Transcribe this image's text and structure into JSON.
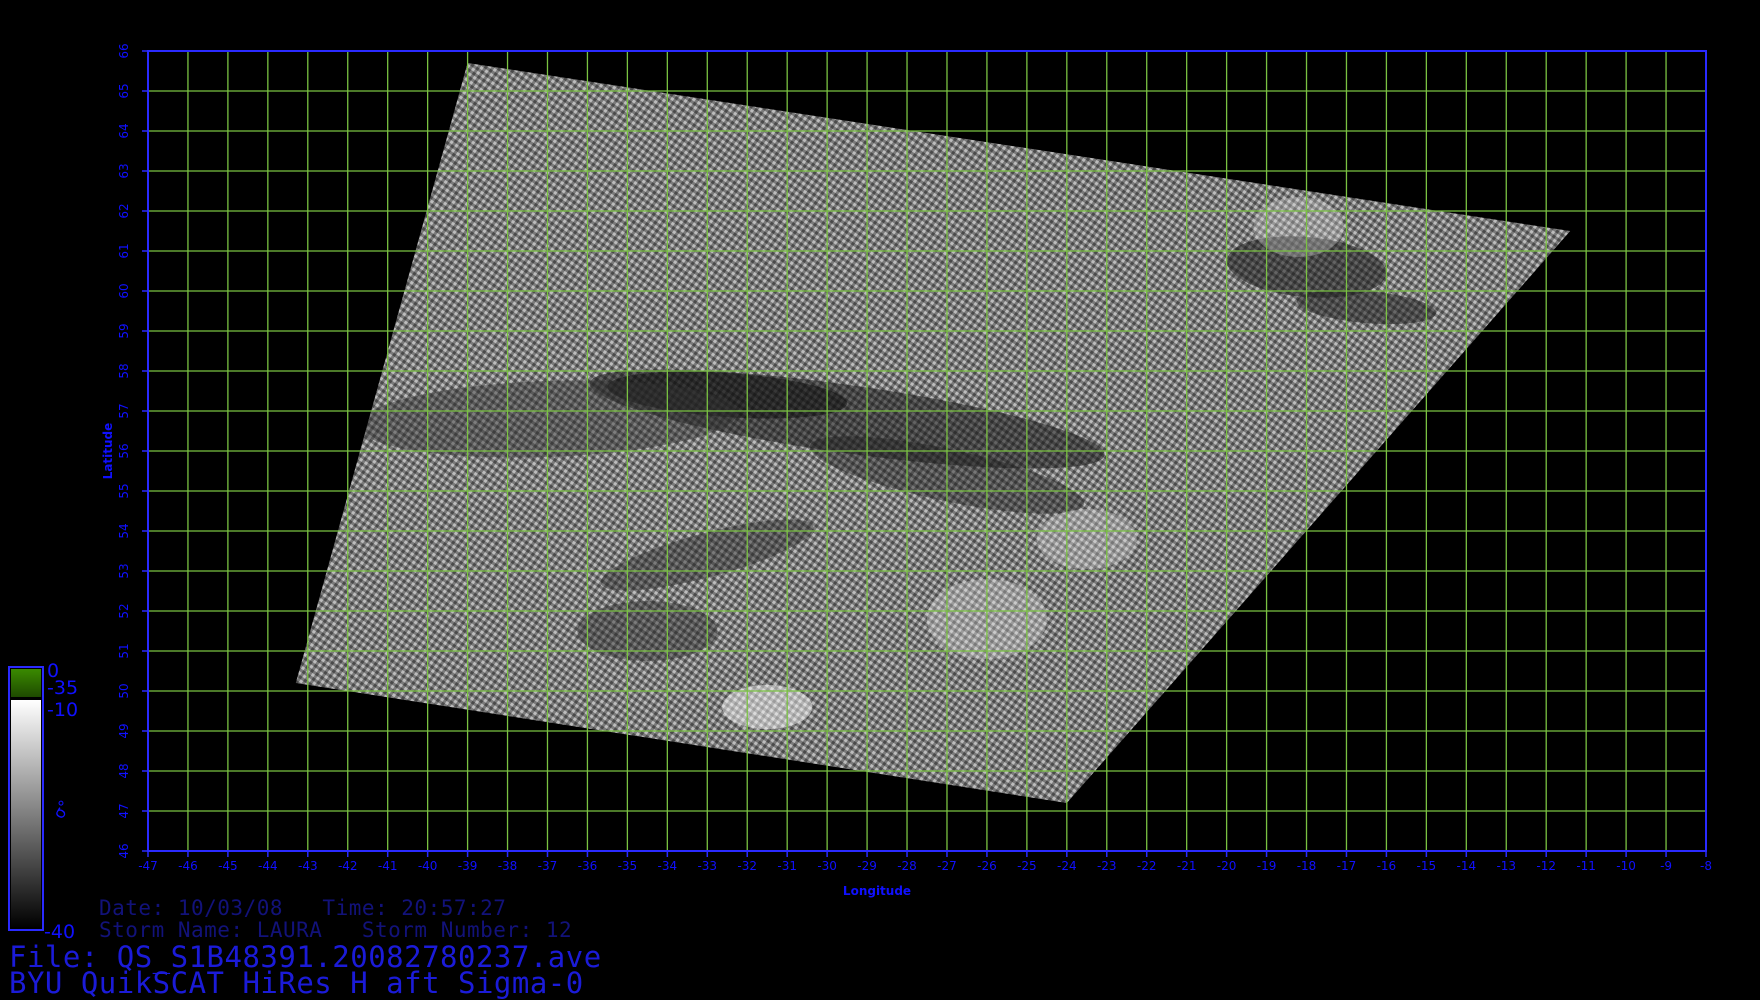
{
  "map": {
    "lon_range": [
      -47,
      -8
    ],
    "lat_range": [
      46,
      66
    ],
    "x_label": "Longitude",
    "y_label": "Latitude",
    "x_ticks": [
      "-47",
      "-46",
      "-45",
      "-44",
      "-43",
      "-42",
      "-41",
      "-40",
      "-39",
      "-38",
      "-37",
      "-36",
      "-35",
      "-34",
      "-33",
      "-32",
      "-31",
      "-30",
      "-29",
      "-28",
      "-27",
      "-26",
      "-25",
      "-24",
      "-23",
      "-22",
      "-21",
      "-20",
      "-19",
      "-18",
      "-17",
      "-16",
      "-15",
      "-14",
      "-13",
      "-12",
      "-11",
      "-10",
      "-9",
      "-8"
    ],
    "y_ticks": [
      "46",
      "47",
      "48",
      "49",
      "50",
      "51",
      "52",
      "53",
      "54",
      "55",
      "56",
      "57",
      "58",
      "59",
      "60",
      "61",
      "62",
      "63",
      "64",
      "65",
      "66"
    ],
    "grid_color": "#7ac242",
    "frame_color": "#2a2aff",
    "swath_corners_lonlat": [
      [
        -39.0,
        65.7
      ],
      [
        -11.4,
        61.5
      ],
      [
        -24.0,
        47.2
      ],
      [
        -43.3,
        50.2
      ]
    ]
  },
  "colorbar": {
    "labels": {
      "top": "0",
      "upper": "-35",
      "mid": "-10",
      "bottom": "-40",
      "symbol": "σ°"
    },
    "colors": {
      "top": "#3a8a00",
      "bottom": "#000000",
      "white": "#ffffff"
    }
  },
  "info": {
    "date_line": "Date: 10/03/08   Time: 20:57:27",
    "storm_line": "Storm Name: LAURA   Storm Number: 12",
    "file_line": "File: QS_S1B48391.20082780237.ave",
    "title_line": "BYU QuikSCAT HiRes H aft Sigma-0"
  }
}
